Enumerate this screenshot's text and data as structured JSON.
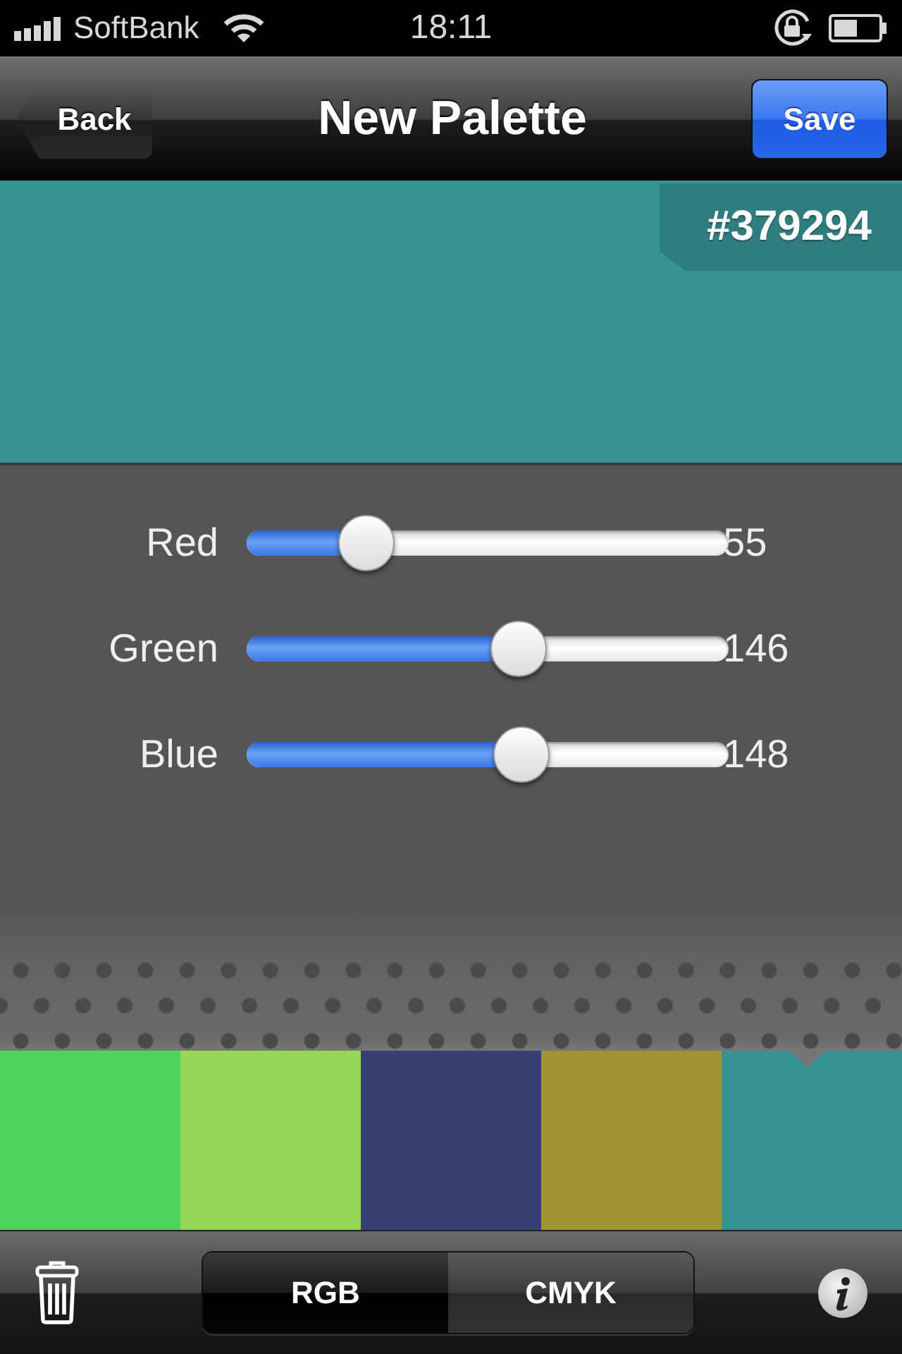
{
  "status_bar": {
    "carrier": "SoftBank",
    "time": "18:11"
  },
  "nav_bar": {
    "back": "Back",
    "title": "New Palette",
    "save": "Save"
  },
  "preview": {
    "hex": "#379294"
  },
  "sliders": [
    {
      "label": "Red",
      "level": 0.216,
      "reading": "55"
    },
    {
      "label": "Green",
      "level": 0.573,
      "reading": "146"
    },
    {
      "label": "Blue",
      "level": 0.58,
      "reading": "148"
    }
  ],
  "palette": [
    {
      "color": "#4cd55a",
      "selected": false
    },
    {
      "color": "#98d65a",
      "selected": false
    },
    {
      "color": "#3a3f72",
      "selected": false
    },
    {
      "color": "#9f9537",
      "selected": false
    },
    {
      "color": "#379294",
      "selected": true
    }
  ],
  "toolbar": {
    "segments": [
      {
        "label": "RGB",
        "selected": true
      },
      {
        "label": "CMYK",
        "selected": false
      }
    ]
  }
}
